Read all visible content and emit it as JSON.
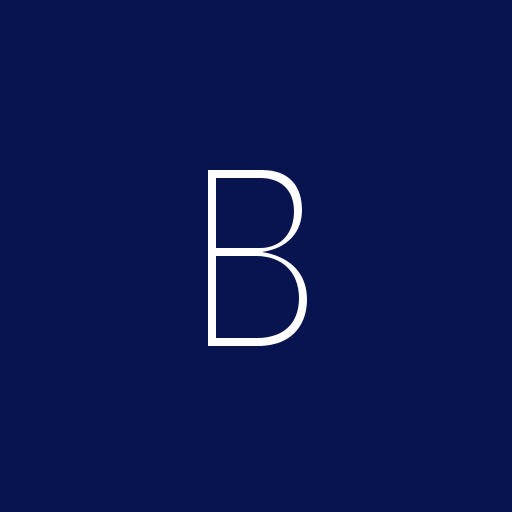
{
  "app_icon": {
    "letter": "B",
    "background_color": "#08144f",
    "foreground_color": "#ffffff"
  }
}
